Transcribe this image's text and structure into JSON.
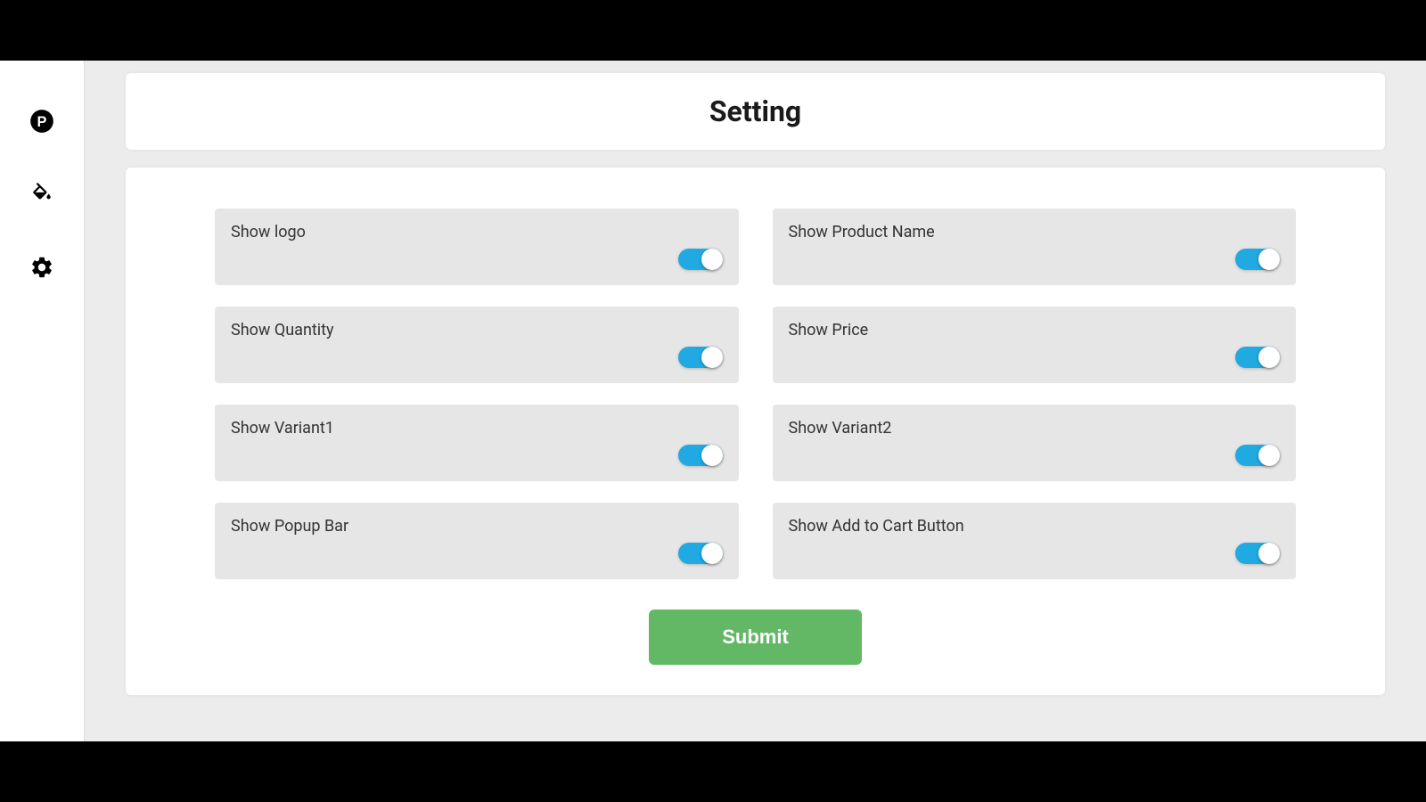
{
  "header": {
    "title": "Setting"
  },
  "sidebar": {
    "items": [
      {
        "name": "p-circle-icon",
        "type": "p-circle"
      },
      {
        "name": "fill-icon",
        "type": "fill"
      },
      {
        "name": "gear-icon",
        "type": "gear"
      }
    ]
  },
  "settings": [
    {
      "id": "show-logo",
      "label": "Show logo",
      "enabled": true
    },
    {
      "id": "show-product-name",
      "label": "Show Product Name",
      "enabled": true
    },
    {
      "id": "show-quantity",
      "label": "Show Quantity",
      "enabled": true
    },
    {
      "id": "show-price",
      "label": "Show Price",
      "enabled": true
    },
    {
      "id": "show-variant1",
      "label": "Show Variant1",
      "enabled": true
    },
    {
      "id": "show-variant2",
      "label": "Show Variant2",
      "enabled": true
    },
    {
      "id": "show-popup-bar",
      "label": "Show Popup Bar",
      "enabled": true
    },
    {
      "id": "show-add-to-cart",
      "label": "Show Add to Cart Button",
      "enabled": true
    }
  ],
  "actions": {
    "submit_label": "Submit"
  },
  "colors": {
    "toggle_on": "#21a9e1",
    "submit_bg": "#63b865",
    "page_bg": "#ececec",
    "setting_bg": "#e6e6e6"
  }
}
